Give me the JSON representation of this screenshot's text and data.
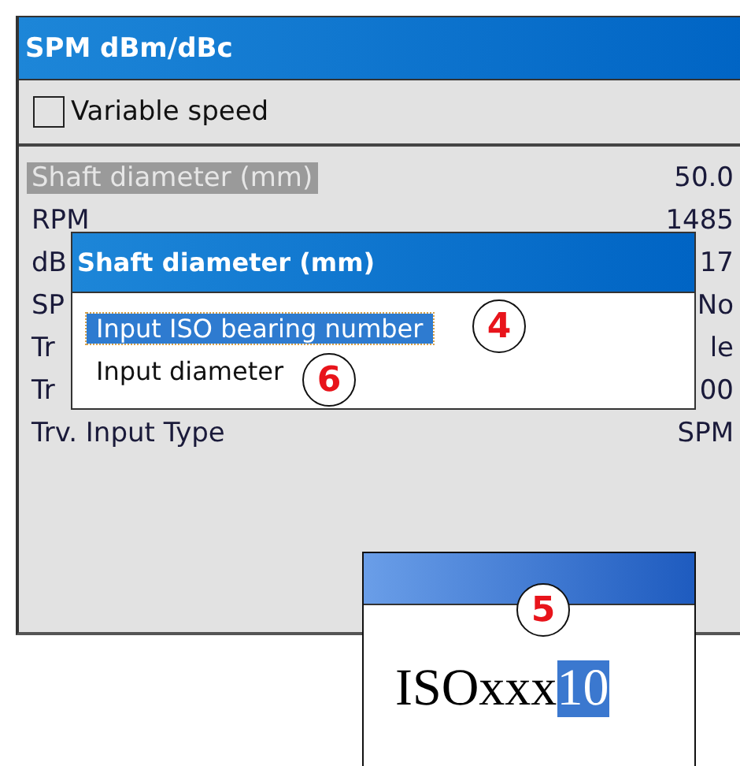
{
  "window": {
    "title": "SPM dBm/dBc"
  },
  "variable_speed": {
    "label": "Variable speed",
    "checked": false
  },
  "parameters": [
    {
      "label": "Shaft diameter (mm)",
      "value": "50.0",
      "selected": true
    },
    {
      "label": "RPM",
      "value": "1485",
      "selected": false
    },
    {
      "label": "dB",
      "value": "17",
      "selected": false
    },
    {
      "label": "SP",
      "value": "No",
      "selected": false
    },
    {
      "label": "Tr",
      "value": "le",
      "selected": false
    },
    {
      "label": "Tr",
      "value": "00",
      "selected": false
    },
    {
      "label": "Trv. Input Type",
      "value": "SPM",
      "selected": false
    }
  ],
  "menu_dialog": {
    "title": "Shaft diameter (mm)",
    "options": [
      {
        "label": "Input ISO bearing number",
        "selected": true
      },
      {
        "label": "Input diameter",
        "selected": false
      }
    ]
  },
  "input_dialog": {
    "text": "ISOxxx",
    "selected_text": "10"
  },
  "callouts": [
    {
      "text": "4"
    },
    {
      "text": "6"
    },
    {
      "text": "5"
    }
  ]
}
